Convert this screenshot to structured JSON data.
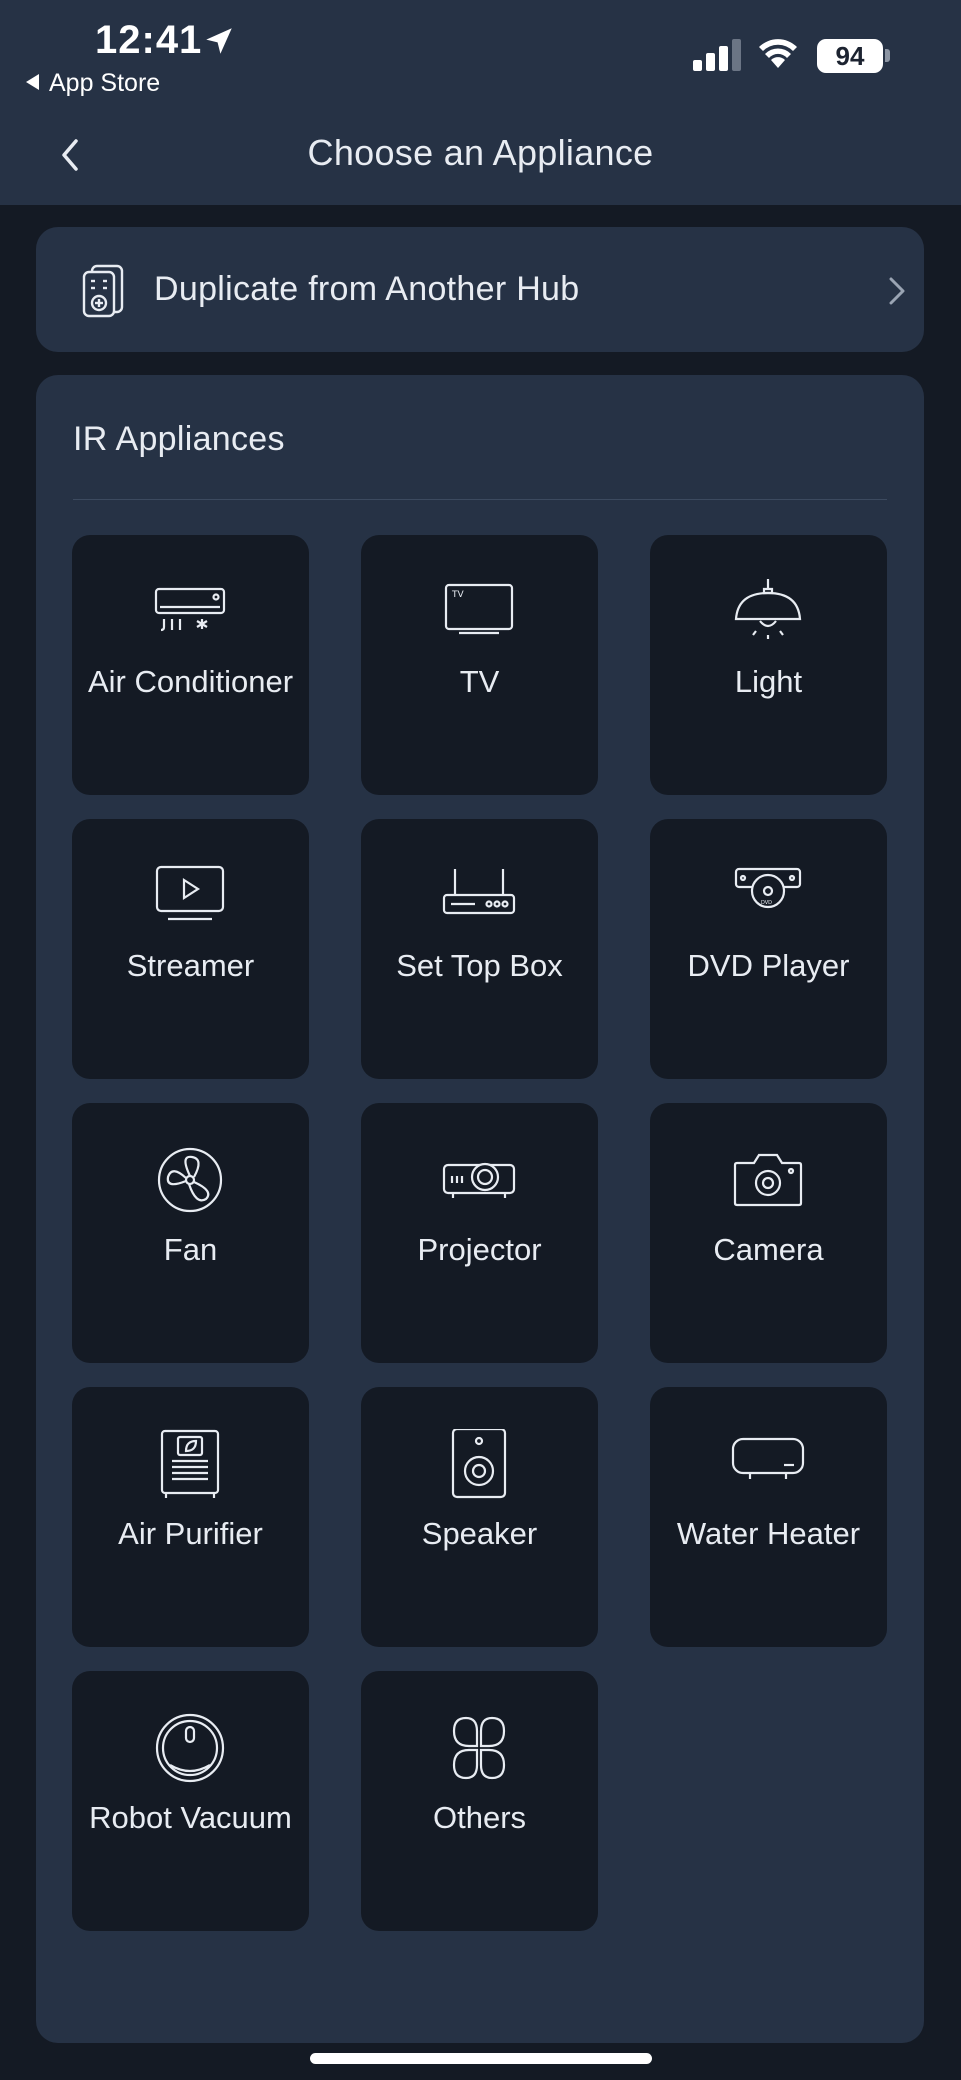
{
  "status_bar": {
    "time": "12:41",
    "back_app": "App Store",
    "battery": "94"
  },
  "header": {
    "title": "Choose an Appliance"
  },
  "duplicate": {
    "label": "Duplicate from Another Hub"
  },
  "ir_section": {
    "title": "IR Appliances",
    "items": [
      {
        "label": "Air Conditioner",
        "icon": "air-conditioner-icon"
      },
      {
        "label": "TV",
        "icon": "tv-icon"
      },
      {
        "label": "Light",
        "icon": "light-icon"
      },
      {
        "label": "Streamer",
        "icon": "streamer-icon"
      },
      {
        "label": "Set Top Box",
        "icon": "set-top-box-icon"
      },
      {
        "label": "DVD Player",
        "icon": "dvd-player-icon"
      },
      {
        "label": "Fan",
        "icon": "fan-icon"
      },
      {
        "label": "Projector",
        "icon": "projector-icon"
      },
      {
        "label": "Camera",
        "icon": "camera-icon"
      },
      {
        "label": "Air Purifier",
        "icon": "air-purifier-icon"
      },
      {
        "label": "Speaker",
        "icon": "speaker-icon"
      },
      {
        "label": "Water Heater",
        "icon": "water-heater-icon"
      },
      {
        "label": "Robot Vacuum",
        "icon": "robot-vacuum-icon"
      },
      {
        "label": "Others",
        "icon": "others-icon"
      }
    ]
  },
  "colors": {
    "background": "#141a24",
    "card": "#263245",
    "tile": "#141a24",
    "text": "#e8ecf2"
  }
}
